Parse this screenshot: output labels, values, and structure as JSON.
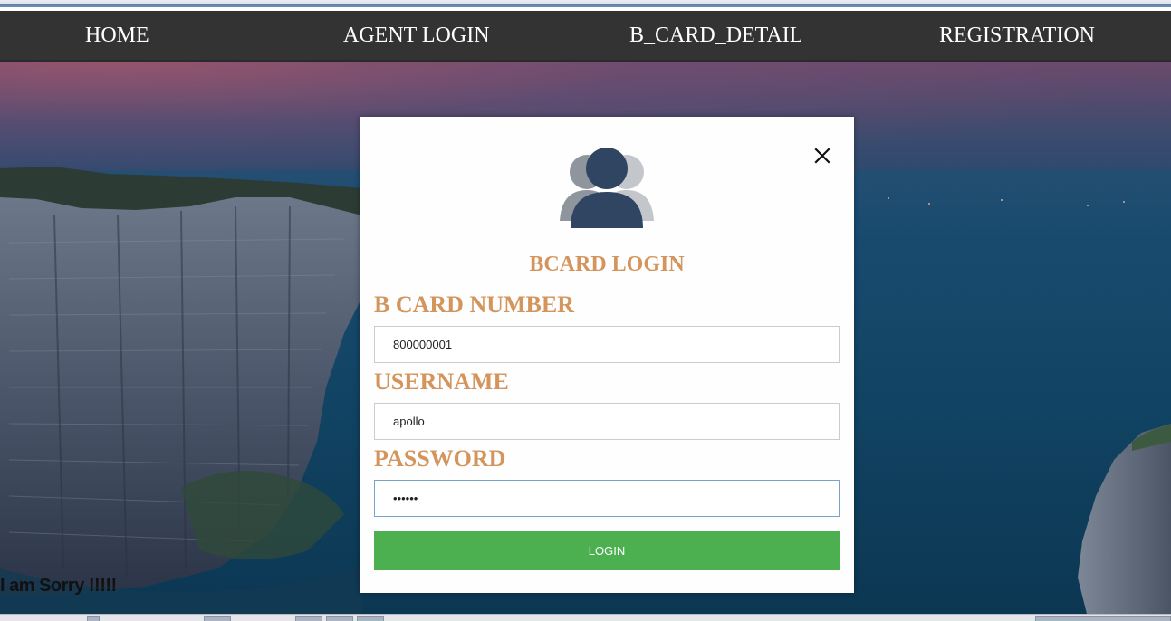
{
  "nav": {
    "items": [
      {
        "label": "HOME"
      },
      {
        "label": "AGENT LOGIN"
      },
      {
        "label": "B_CARD_DETAIL"
      },
      {
        "label": "REGISTRATION"
      }
    ]
  },
  "modal": {
    "title": "BCARD LOGIN",
    "close_icon": "close-icon",
    "avatar_icon": "users-icon",
    "fields": {
      "card_number": {
        "label": "B CARD NUMBER",
        "value": "800000001"
      },
      "username": {
        "label": "USERNAME",
        "value": "apollo"
      },
      "password": {
        "label": "PASSWORD",
        "value": "••••••"
      }
    },
    "login_label": "LOGIN"
  },
  "message": "I am Sorry !!!!!",
  "colors": {
    "nav_bg": "#333333",
    "label_color": "#d4955c",
    "login_button": "#4caf50"
  }
}
